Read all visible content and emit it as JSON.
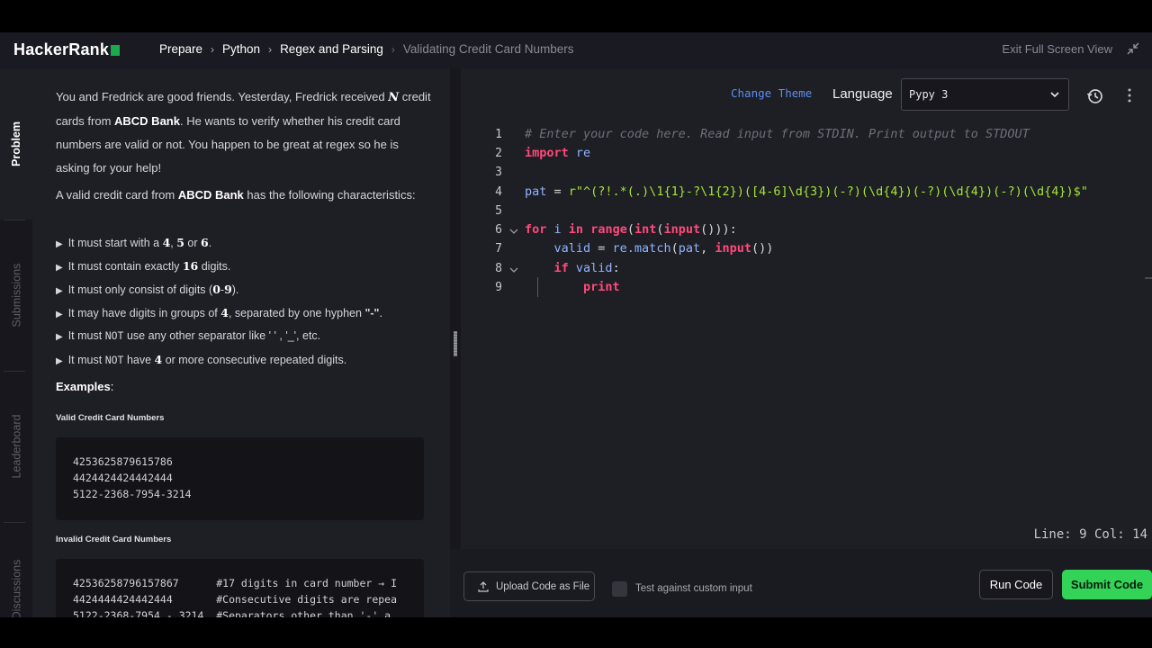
{
  "app": {
    "logo": "HackerRank"
  },
  "breadcrumb": [
    "Prepare",
    "Python",
    "Regex and Parsing",
    "Validating Credit Card Numbers"
  ],
  "header": {
    "exit_fullscreen": "Exit Full Screen View"
  },
  "side_tabs": [
    "Problem",
    "Submissions",
    "Leaderboard",
    "Discussions"
  ],
  "problem": {
    "intro_pre": "You and Fredrick are good friends. Yesterday, Fredrick received ",
    "intro_var": "N",
    "intro_mid": " credit cards from ",
    "bank": "ABCD Bank",
    "intro_post": ". He wants to verify whether his credit card numbers are valid or not. You happen to be great at regex so he is asking for your help!",
    "valid_pre": "A valid credit card from ",
    "valid_post": " has the following characteristics:",
    "rules": [
      {
        "parts": [
          "It must start with a ",
          "4",
          ", ",
          "5",
          " or ",
          "6",
          "."
        ]
      },
      {
        "parts": [
          "It must contain exactly ",
          "16",
          " digits."
        ]
      },
      {
        "parts": [
          "It must only consist of digits (",
          "0",
          "-",
          "9",
          ")."
        ]
      },
      {
        "parts": [
          "It may have digits in groups of ",
          "4",
          ", separated by one hyphen ",
          "\"-\"",
          "."
        ]
      },
      {
        "parts": [
          "It must ",
          "NOT",
          " use any other separator like ' ' , '_', etc."
        ]
      },
      {
        "parts": [
          "It must ",
          "NOT",
          " have ",
          "4",
          " or more consecutive repeated digits."
        ]
      }
    ],
    "examples_label": "Examples",
    "examples_colon": ":",
    "valid_heading": "Valid Credit Card Numbers",
    "valid_numbers": [
      "4253625879615786",
      "4424424424442444",
      "5122-2368-7954-3214"
    ],
    "invalid_heading": "Invalid Credit Card Numbers",
    "invalid_numbers": [
      "42536258796157867      #17 digits in card number → I",
      "4424444424442444       #Consecutive digits are repea",
      "5122-2368-7954 - 3214  #Separators other than '-' a"
    ]
  },
  "editor": {
    "change_theme": "Change Theme",
    "language_label": "Language",
    "language_value": "Pypy 3",
    "line_numbers": [
      "1",
      "2",
      "3",
      "4",
      "5",
      "6",
      "7",
      "8",
      "9"
    ],
    "code": {
      "l1": "# Enter your code here. Read input from STDIN. Print output to STDOUT",
      "l2_kw": "import",
      "l2_mod": " re",
      "l4_var": "pat",
      "l4_eq": " = ",
      "l4_str": "r\"^(?!.*(.)\\1{1}-?\\1{2})([4-6]\\d{3})(-?)(\\d{4})(-?)(\\d{4})(-?)(\\d{4})$\"",
      "l6_for": "for",
      "l6_i": " i ",
      "l6_in": "in",
      "l6_sp": " ",
      "l6_range": "range",
      "l6_p1": "(",
      "l6_int": "int",
      "l6_p2": "(",
      "l6_input": "input",
      "l6_end": "())):",
      "l7_indent": "    ",
      "l7_var": "valid",
      "l7_eq": " = ",
      "l7_re": "re.match",
      "l7_p": "(",
      "l7_pat": "pat",
      "l7_c": ", ",
      "l7_input": "input",
      "l7_end": "())",
      "l8_indent": "    ",
      "l8_if": "if",
      "l8_var": " valid",
      "l8_colon": ":",
      "l9_indent": "        ",
      "l9_print": "print"
    },
    "status": "Line: 9 Col: 14"
  },
  "footer": {
    "upload": "Upload Code as File",
    "custom_input": "Test against custom input",
    "run": "Run Code",
    "submit": "Submit Code"
  },
  "colors": {
    "accent_green": "#32d357",
    "link_blue": "#5b8ef0",
    "keyword": "#ff4a7a",
    "string": "#a3e635"
  }
}
